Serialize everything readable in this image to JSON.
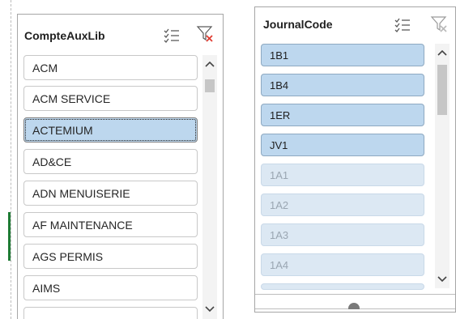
{
  "slicer1": {
    "title": "CompteAuxLib",
    "items": [
      {
        "label": "ACM",
        "state": "normal"
      },
      {
        "label": "ACM SERVICE",
        "state": "normal"
      },
      {
        "label": "ACTEMIUM",
        "state": "selected"
      },
      {
        "label": "AD&CE",
        "state": "normal"
      },
      {
        "label": "ADN MENUISERIE",
        "state": "normal"
      },
      {
        "label": "AF MAINTENANCE",
        "state": "normal"
      },
      {
        "label": "AGS PERMIS",
        "state": "normal"
      },
      {
        "label": "AIMS",
        "state": "normal"
      },
      {
        "label": "",
        "state": "normal"
      }
    ]
  },
  "slicer2": {
    "title": "JournalCode",
    "items": [
      {
        "label": "1B1",
        "state": "selected"
      },
      {
        "label": "1B4",
        "state": "selected"
      },
      {
        "label": "1ER",
        "state": "selected"
      },
      {
        "label": "JV1",
        "state": "selected"
      },
      {
        "label": "1A1",
        "state": "nodata"
      },
      {
        "label": "1A2",
        "state": "nodata"
      },
      {
        "label": "1A3",
        "state": "nodata"
      },
      {
        "label": "1A4",
        "state": "nodata"
      },
      {
        "label": "",
        "state": "nodata"
      }
    ]
  },
  "icons": {
    "multi_select": "multi-select-icon",
    "clear_filter": "clear-filter-icon",
    "scroll_up": "chevron-up-icon",
    "scroll_down": "chevron-down-icon"
  },
  "colors": {
    "selected_fill": "#bdd7ee",
    "nodata_fill": "#dce8f3",
    "clear_filter_x": "#e03c31"
  }
}
